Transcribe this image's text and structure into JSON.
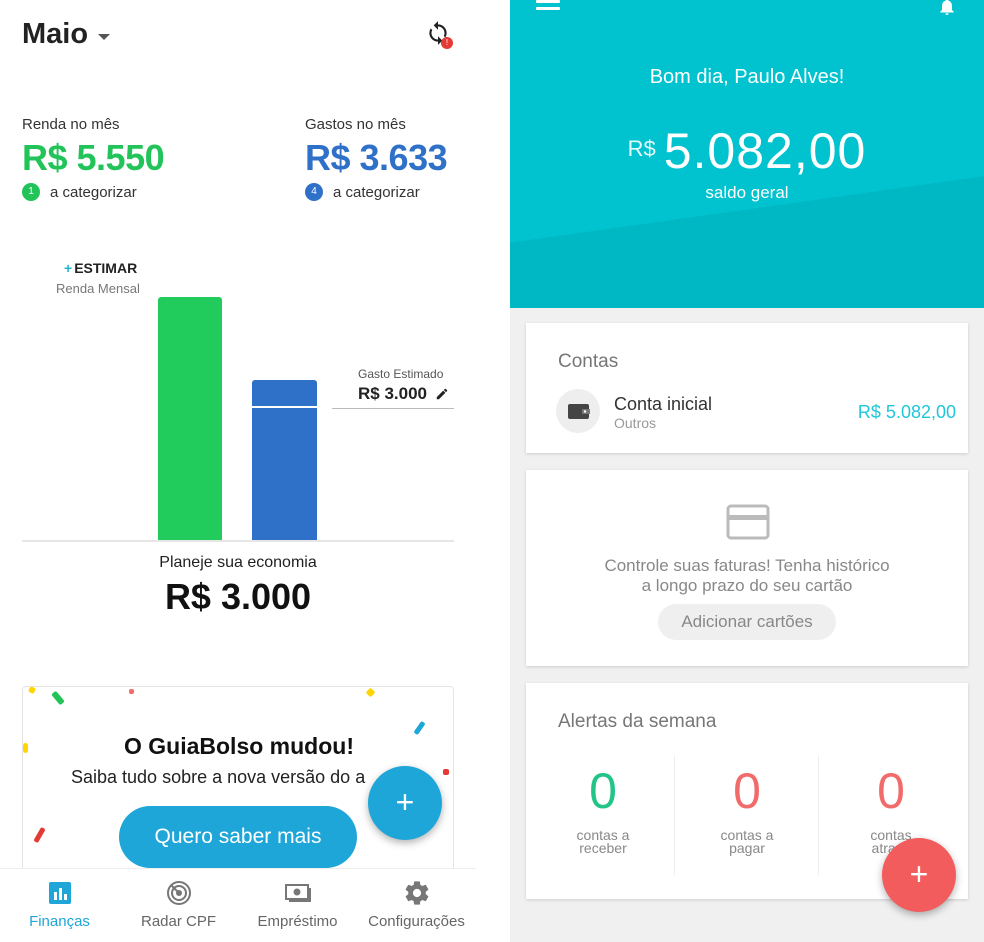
{
  "left": {
    "month": "Maio",
    "renda": {
      "label": "Renda no mês",
      "value": "R$ 5.550",
      "badge": "1",
      "badge_text": "a categorizar"
    },
    "gastos": {
      "label": "Gastos no mês",
      "value": "R$ 3.633",
      "badge": "4",
      "badge_text": "a categorizar"
    },
    "chart": {
      "estimar_plus": "+",
      "estimar_label": "ESTIMAR",
      "renda_mensal": "Renda Mensal",
      "gasto_estimado_label": "Gasto Estimado",
      "gasto_estimado_value": "R$ 3.000"
    },
    "planeje_label": "Planeje sua economia",
    "planeje_value": "R$ 3.000",
    "promo": {
      "title": "O GuiaBolso mudou!",
      "subtitle": "Saiba tudo sobre a nova versão do a",
      "button": "Quero saber mais"
    },
    "fab": "+",
    "nav": [
      {
        "label": "Finanças",
        "icon": "bar-chart-icon"
      },
      {
        "label": "Radar CPF",
        "icon": "radar-icon"
      },
      {
        "label": "Empréstimo",
        "icon": "money-icon"
      },
      {
        "label": "Configurações",
        "icon": "gear-icon"
      }
    ],
    "colors": {
      "green": "#22c45a",
      "blue": "#2f70c9",
      "accent": "#1fa6d8"
    }
  },
  "right": {
    "greeting": "Bom dia, Paulo Alves!",
    "currency": "R$",
    "balance": "5.082,00",
    "balance_label": "saldo geral",
    "contas": {
      "title": "Contas",
      "account_name": "Conta inicial",
      "account_type": "Outros",
      "account_value": "R$ 5.082,00"
    },
    "faturas": {
      "line1": "Controle suas faturas! Tenha histórico",
      "line2": "a longo prazo do seu cartão",
      "button": "Adicionar cartões"
    },
    "alertas": {
      "title": "Alertas da semana",
      "items": [
        {
          "num": "0",
          "cap1": "contas a",
          "cap2": "receber",
          "color": "#22c487"
        },
        {
          "num": "0",
          "cap1": "contas a",
          "cap2": "pagar",
          "color": "#f26b6b"
        },
        {
          "num": "0",
          "cap1": "contas",
          "cap2": "atrasa",
          "color": "#f26b6b"
        }
      ]
    },
    "fab": "+",
    "colors": {
      "header": "#00c3cf",
      "value": "#1fc7da",
      "fab": "#f25c5c"
    }
  }
}
